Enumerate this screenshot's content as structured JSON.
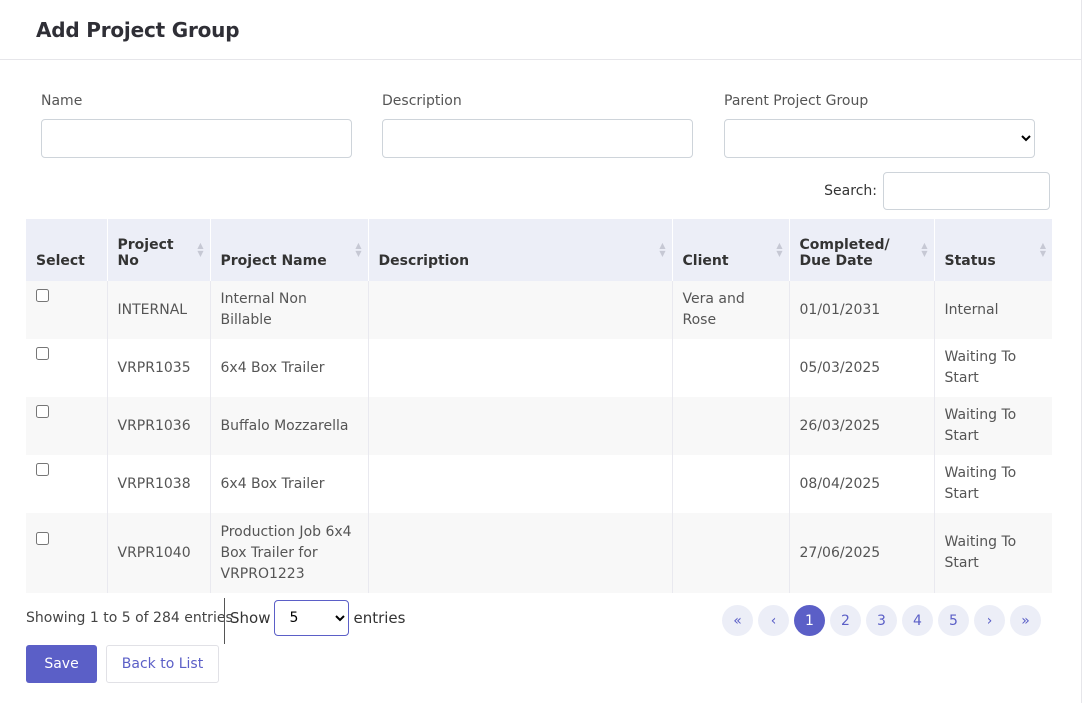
{
  "header": {
    "title": "Add Project Group"
  },
  "form": {
    "name_label": "Name",
    "name_value": "",
    "description_label": "Description",
    "description_value": "",
    "parent_label": "Parent Project Group",
    "parent_value": ""
  },
  "search": {
    "label": "Search:",
    "value": ""
  },
  "table": {
    "columns": [
      "Select",
      "Project No",
      "Project Name",
      "Description",
      "Client",
      "Completed/ Due Date",
      "Status"
    ],
    "column_lines": {
      "project_no": [
        "Project",
        "No"
      ],
      "due_date": [
        "Completed/",
        "Due Date"
      ]
    },
    "rows": [
      {
        "project_no": "INTERNAL",
        "project_name": "Internal Non Billable",
        "description": "",
        "client": "Vera and Rose",
        "due_date": "01/01/2031",
        "status": "Internal"
      },
      {
        "project_no": "VRPR1035",
        "project_name": "6x4 Box Trailer",
        "description": "",
        "client": "",
        "due_date": "05/03/2025",
        "status": "Waiting To Start"
      },
      {
        "project_no": "VRPR1036",
        "project_name": "Buffalo Mozzarella",
        "description": "",
        "client": "",
        "due_date": "26/03/2025",
        "status": "Waiting To Start"
      },
      {
        "project_no": "VRPR1038",
        "project_name": "6x4 Box Trailer",
        "description": "",
        "client": "",
        "due_date": "08/04/2025",
        "status": "Waiting To Start"
      },
      {
        "project_no": "VRPR1040",
        "project_name": "Production Job 6x4 Box Trailer for VRPRO1223",
        "description": "",
        "client": "",
        "due_date": "27/06/2025",
        "status": "Waiting To Start"
      }
    ]
  },
  "footer": {
    "info": "Showing 1 to 5 of 284 entries",
    "show_label": "Show",
    "page_size": "5",
    "entries_label": "entries",
    "pages": [
      "1",
      "2",
      "3",
      "4",
      "5"
    ],
    "current_page": "1"
  },
  "actions": {
    "save_label": "Save",
    "back_label": "Back to List"
  },
  "colors": {
    "accent": "#5b5fc7",
    "header_bg": "#eceef7",
    "stripe": "#f8f8f8"
  }
}
